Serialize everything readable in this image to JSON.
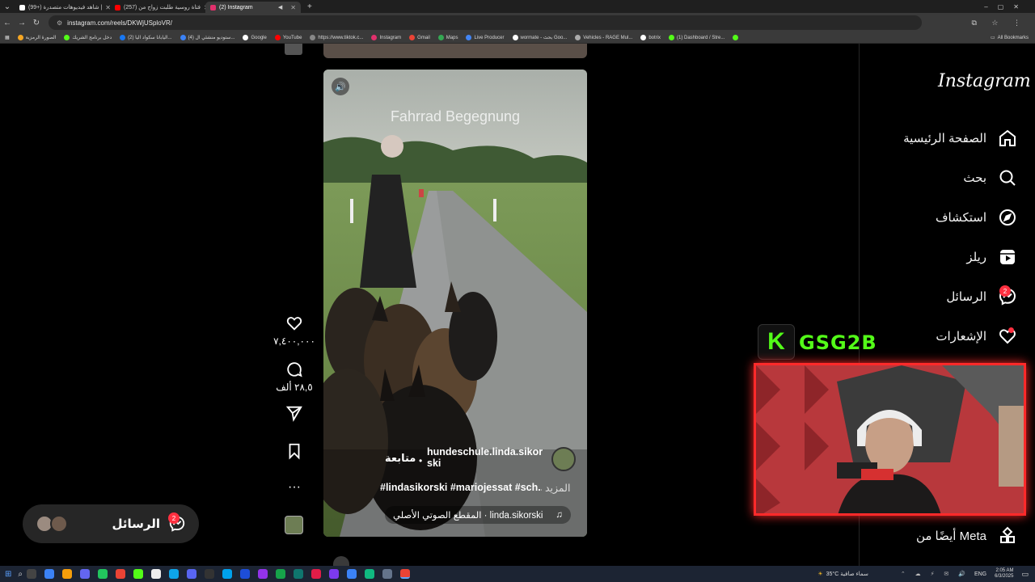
{
  "browser": {
    "tabs": [
      {
        "label": "(99+) شاهد فيديوهات متصدرة |",
        "color": "#ffffff"
      },
      {
        "label": "(257) فتاة روسية طلبت زواج من",
        "color": "#ff0000"
      },
      {
        "label": "(2) Instagram",
        "color": "#e1306c",
        "active": true
      }
    ],
    "url": "instagram.com/reels/DKWjUSploVR/",
    "bookmarks": [
      "الصورة الرمزية",
      "دخل برنامج الشريك",
      "(2) اليابانا سكواد اليا...",
      "(4) ستوديو منشئي ال...",
      "Google",
      "YouTube",
      "https://www.tiktok.c...",
      "Instagram",
      "Gmail",
      "Maps",
      "Live Producer",
      "wormate - بحث Goo...",
      "Vehicles - RAGE Mul...",
      "botrix",
      "(1) Dashboard / Stre..."
    ],
    "all_bookmarks": "All Bookmarks"
  },
  "instagram": {
    "logo": "Instagram",
    "nav": [
      {
        "label": "الصفحة الرئيسية",
        "icon": "home-icon"
      },
      {
        "label": "بحث",
        "icon": "search-icon"
      },
      {
        "label": "استكشاف",
        "icon": "explore-icon"
      },
      {
        "label": "ريلز",
        "icon": "reels-icon"
      },
      {
        "label": "الرسائل",
        "icon": "messenger-icon",
        "badge": "2"
      },
      {
        "label": "الإشعارات",
        "icon": "heart-icon"
      }
    ],
    "more_from_meta": "أيضًا من Meta"
  },
  "reel": {
    "overlay_title": "Fahrrad Begegnung",
    "username": "hundeschule.linda.sikor ski",
    "follow_label": "متابعة",
    "caption": "#lindasikorski #mariojessat #sch...",
    "more_label": "المزيد",
    "audio_label": "المقطع الصوتي الأصلي · linda.sikorski",
    "likes": "٧,٤٠٠,٠٠٠",
    "comments": "٢٨,٥ ألف"
  },
  "messages_box": {
    "label": "الرسائل",
    "badge": "2"
  },
  "stream_overlay": {
    "channel": "GSG2B"
  },
  "taskbar": {
    "weather": "35°C سماء صافية",
    "lang": "ENG",
    "time": "2:05 AM",
    "date": "6/3/2025"
  }
}
